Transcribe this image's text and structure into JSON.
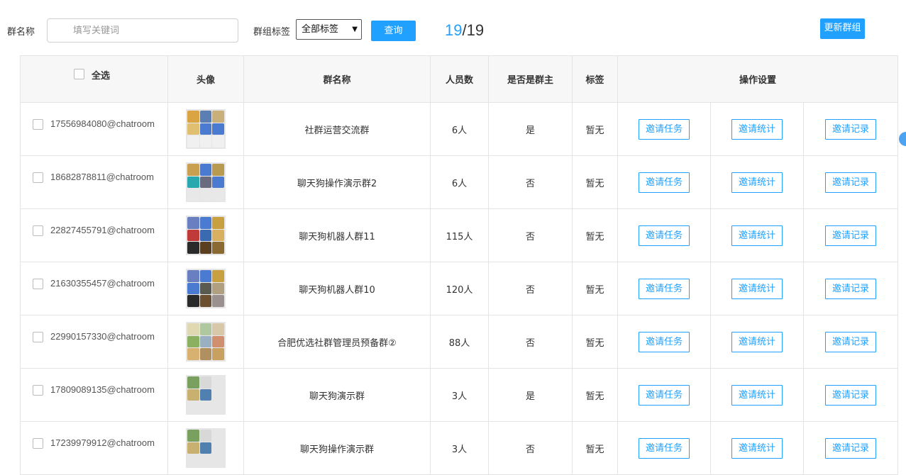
{
  "toolbar": {
    "group_name_label": "群名称",
    "search_placeholder": "填写关键词",
    "tag_label": "群组标签",
    "tag_selected": "全部标签",
    "query_label": "查询",
    "page_current": "19",
    "page_total": "/19",
    "update_label": "更新群组"
  },
  "table": {
    "select_all": "全选",
    "headers": [
      "头像",
      "群名称",
      "人员数",
      "是否是群主",
      "标签",
      "操作设置"
    ],
    "ops": [
      "邀请任务",
      "邀请统计",
      "邀请记录"
    ],
    "rows": [
      {
        "id": "17556984080@chatroom",
        "name": "社群运营交流群",
        "members": "6人",
        "owner": "是",
        "tag": "暂无"
      },
      {
        "id": "18682878811@chatroom",
        "name": "聊天狗操作演示群2",
        "members": "6人",
        "owner": "否",
        "tag": "暂无"
      },
      {
        "id": "22827455791@chatroom",
        "name": "聊天狗机器人群11",
        "members": "115人",
        "owner": "否",
        "tag": "暂无"
      },
      {
        "id": "21630355457@chatroom",
        "name": "聊天狗机器人群10",
        "members": "120人",
        "owner": "否",
        "tag": "暂无"
      },
      {
        "id": "22990157330@chatroom",
        "name": "合肥优选社群管理员预备群②",
        "members": "88人",
        "owner": "否",
        "tag": "暂无"
      },
      {
        "id": "17809089135@chatroom",
        "name": "聊天狗演示群",
        "members": "3人",
        "owner": "是",
        "tag": "暂无"
      },
      {
        "id": "17239979912@chatroom",
        "name": "聊天狗操作演示群",
        "members": "3人",
        "owner": "否",
        "tag": "暂无"
      }
    ]
  },
  "colors": {
    "accent": "#20a0ff",
    "header_bg": "#f7f7f7",
    "border": "#e4e4e4"
  }
}
